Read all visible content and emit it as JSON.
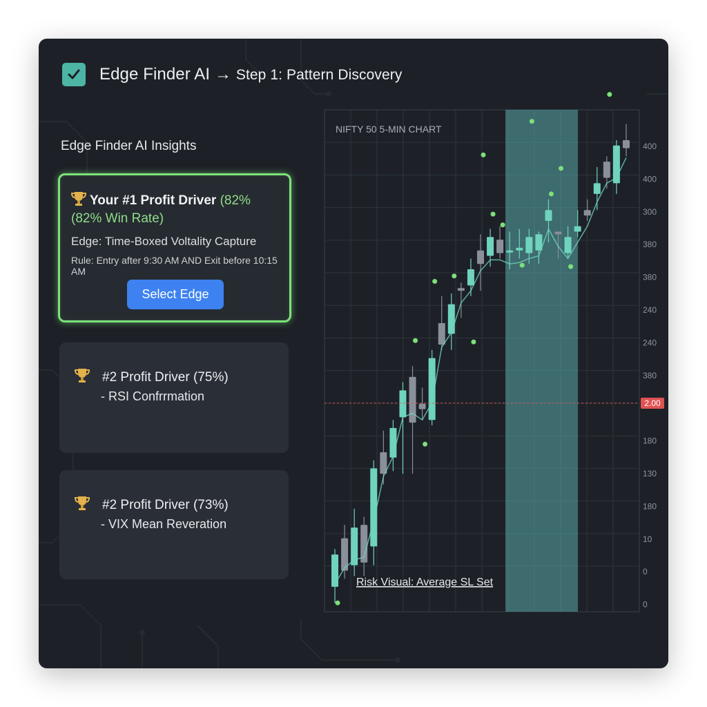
{
  "header": {
    "title": "Edge Finder AI",
    "arrow": "→",
    "step": "Step 1: Pattern Discovery",
    "icon": "checkbox-icon"
  },
  "insights": {
    "title": "Edge Finder AI Insights",
    "cards": [
      {
        "title": "Your #1 Profit Driver",
        "title_suffix": "(82%",
        "title_line2": "(82% Win Rate)",
        "edge": "Edge: Time-Boxed Voltality Capture",
        "rule": "Rule: Entry after 9:30 AM AND Exit before 10:15 AM",
        "button_label": "Select Edge"
      },
      {
        "title": "#2 Profit Driver (75%)",
        "subtitle": "- RSI Confrrmation"
      },
      {
        "title": "#2 Profit Driver (73%)",
        "subtitle": "- VIX Mean Reveration"
      }
    ]
  },
  "colors": {
    "background": "#1d2127",
    "card": "#2a2f37",
    "accent_green": "#7de27a",
    "candle_up": "#6fd3bd",
    "candle_down": "#8a9099",
    "highlight_band": "#5aa9aa",
    "price_line": "#e05252",
    "button": "#3d82f0"
  },
  "chart_data": {
    "type": "candlestick",
    "title": "NIFTY 50 5-MIN CHART",
    "annotation": "Risk Visual: Average SL Set",
    "price_marker": "2.00",
    "y_tick_labels": [
      "400",
      "400",
      "300",
      "380",
      "380",
      "240",
      "240",
      "380",
      "2.00",
      "180",
      "130",
      "180",
      "10",
      "0",
      "0"
    ],
    "candles": [
      {
        "open": 40,
        "high": 110,
        "low": 10,
        "close": 100,
        "dir": "up"
      },
      {
        "open": 130,
        "high": 155,
        "low": 55,
        "close": 70,
        "dir": "down"
      },
      {
        "open": 80,
        "high": 185,
        "low": 60,
        "close": 150,
        "dir": "up"
      },
      {
        "open": 155,
        "high": 170,
        "low": 60,
        "close": 85,
        "dir": "down"
      },
      {
        "open": 115,
        "high": 275,
        "low": 80,
        "close": 260,
        "dir": "up"
      },
      {
        "open": 250,
        "high": 330,
        "low": 230,
        "close": 290,
        "dir": "down"
      },
      {
        "open": 280,
        "high": 350,
        "low": 255,
        "close": 335,
        "dir": "up"
      },
      {
        "open": 355,
        "high": 420,
        "low": 250,
        "close": 405,
        "dir": "up"
      },
      {
        "open": 430,
        "high": 450,
        "low": 250,
        "close": 345,
        "dir": "down"
      },
      {
        "open": 380,
        "high": 410,
        "low": 350,
        "close": 370,
        "dir": "down"
      },
      {
        "open": 350,
        "high": 480,
        "low": 340,
        "close": 465,
        "dir": "up"
      },
      {
        "open": 530,
        "high": 580,
        "low": 480,
        "close": 490,
        "dir": "down"
      },
      {
        "open": 510,
        "high": 585,
        "low": 480,
        "close": 565,
        "dir": "up"
      },
      {
        "open": 595,
        "high": 605,
        "low": 540,
        "close": 590,
        "dir": "down"
      },
      {
        "open": 600,
        "high": 650,
        "low": 580,
        "close": 630,
        "dir": "up"
      },
      {
        "open": 640,
        "high": 695,
        "low": 590,
        "close": 665,
        "dir": "down"
      },
      {
        "open": 655,
        "high": 705,
        "low": 635,
        "close": 690,
        "dir": "up"
      },
      {
        "open": 685,
        "high": 710,
        "low": 650,
        "close": 660,
        "dir": "down"
      },
      {
        "open": 665,
        "high": 700,
        "low": 630,
        "close": 665,
        "dir": "up"
      },
      {
        "open": 670,
        "high": 705,
        "low": 650,
        "close": 665,
        "dir": "up"
      },
      {
        "open": 660,
        "high": 705,
        "low": 640,
        "close": 690,
        "dir": "up"
      },
      {
        "open": 665,
        "high": 700,
        "low": 640,
        "close": 695,
        "dir": "up"
      },
      {
        "open": 720,
        "high": 760,
        "low": 680,
        "close": 740,
        "dir": "up"
      },
      {
        "open": 700,
        "high": 690,
        "low": 650,
        "close": 695,
        "dir": "down"
      },
      {
        "open": 660,
        "high": 710,
        "low": 650,
        "close": 690,
        "dir": "up"
      },
      {
        "open": 700,
        "high": 740,
        "low": 690,
        "close": 710,
        "dir": "up"
      },
      {
        "open": 730,
        "high": 760,
        "low": 720,
        "close": 740,
        "dir": "down"
      },
      {
        "open": 770,
        "high": 820,
        "low": 740,
        "close": 790,
        "dir": "up"
      },
      {
        "open": 800,
        "high": 840,
        "low": 780,
        "close": 830,
        "dir": "down"
      },
      {
        "open": 790,
        "high": 870,
        "low": 770,
        "close": 860,
        "dir": "up"
      },
      {
        "open": 870,
        "high": 900,
        "low": 840,
        "close": 855,
        "dir": "down"
      }
    ],
    "highlight_range": {
      "from_index": 16,
      "to_index": 21
    }
  }
}
